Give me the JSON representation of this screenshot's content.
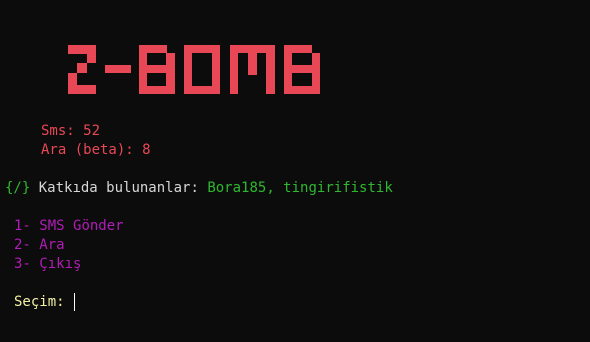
{
  "logo": {
    "text": "Z-BOMB",
    "color": "#e84855"
  },
  "stats": {
    "sms_label": "Sms:",
    "sms_value": "52",
    "ara_label": "Ara (beta):",
    "ara_value": "8"
  },
  "credits": {
    "prefix": "{/}",
    "label": "Katkıda bulunanlar:",
    "names": "Bora185, tingirifistik"
  },
  "menu": {
    "items": [
      {
        "number": "1-",
        "label": "SMS Gönder"
      },
      {
        "number": "2-",
        "label": "Ara"
      },
      {
        "number": "3-",
        "label": "Çıkış"
      }
    ]
  },
  "prompt": {
    "label": "Seçim:",
    "value": ""
  },
  "colors": {
    "background": "#0c0c0c",
    "red": "#e84855",
    "green": "#2fb82f",
    "magenta": "#b01cb6",
    "yellow": "#f3f1a4",
    "white": "#d6d6d6"
  }
}
